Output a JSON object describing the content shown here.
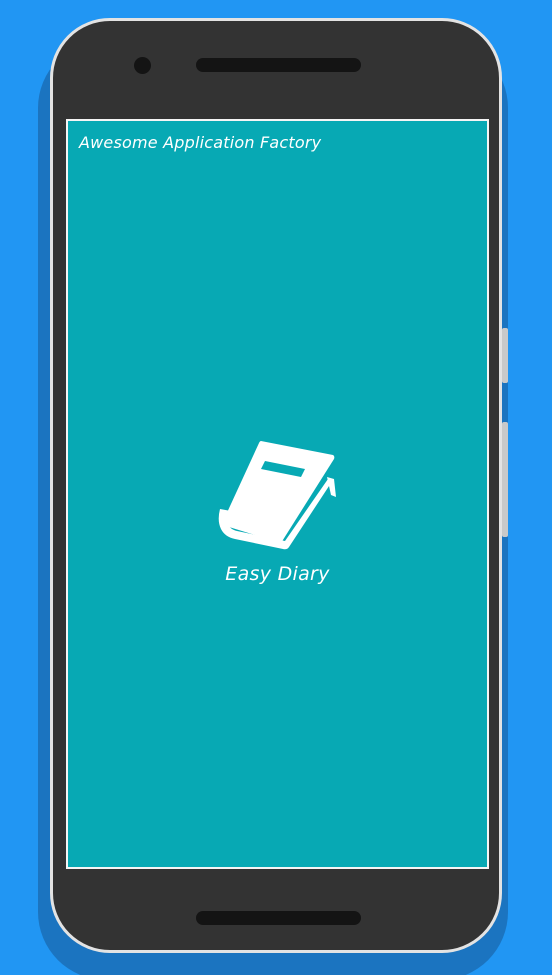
{
  "splash": {
    "company_name": "Awesome Application Factory",
    "app_name": "Easy Diary",
    "logo_icon": "book-icon",
    "background_color": "#07A9B4",
    "text_color": "#FFFFFF"
  },
  "device": {
    "frame_color": "#333333",
    "backdrop_color": "#2196F3"
  }
}
